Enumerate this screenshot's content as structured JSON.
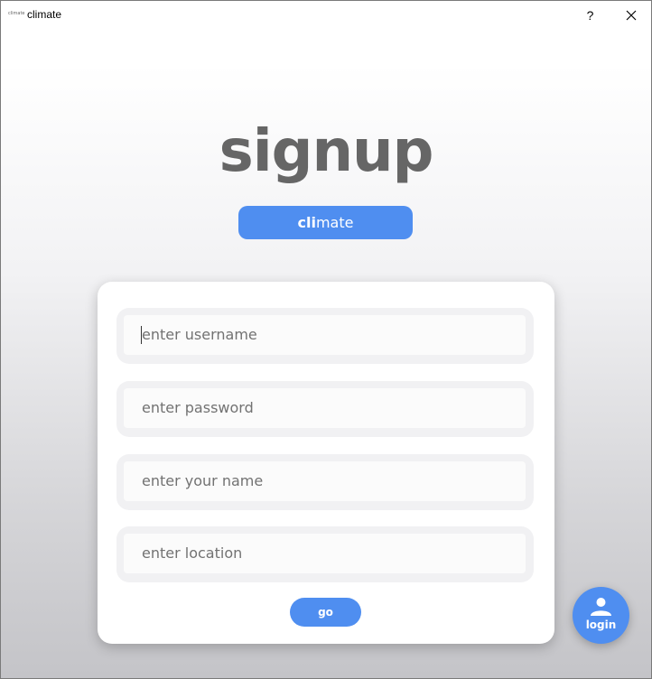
{
  "window": {
    "icon_text": "climate",
    "title": "climate",
    "help_label": "?",
    "close_label": "✕"
  },
  "page": {
    "heading": "signup",
    "brand": {
      "bold_part": "cli",
      "rest": "mate"
    }
  },
  "form": {
    "username_placeholder": "enter username",
    "password_placeholder": "enter password",
    "name_placeholder": "enter your name",
    "location_placeholder": "enter location",
    "submit_label": "go"
  },
  "fab": {
    "icon": "user-icon",
    "label": "login"
  },
  "colors": {
    "accent": "#4f8ef0",
    "heading": "#666666",
    "field_outer": "#f1f1f3"
  }
}
